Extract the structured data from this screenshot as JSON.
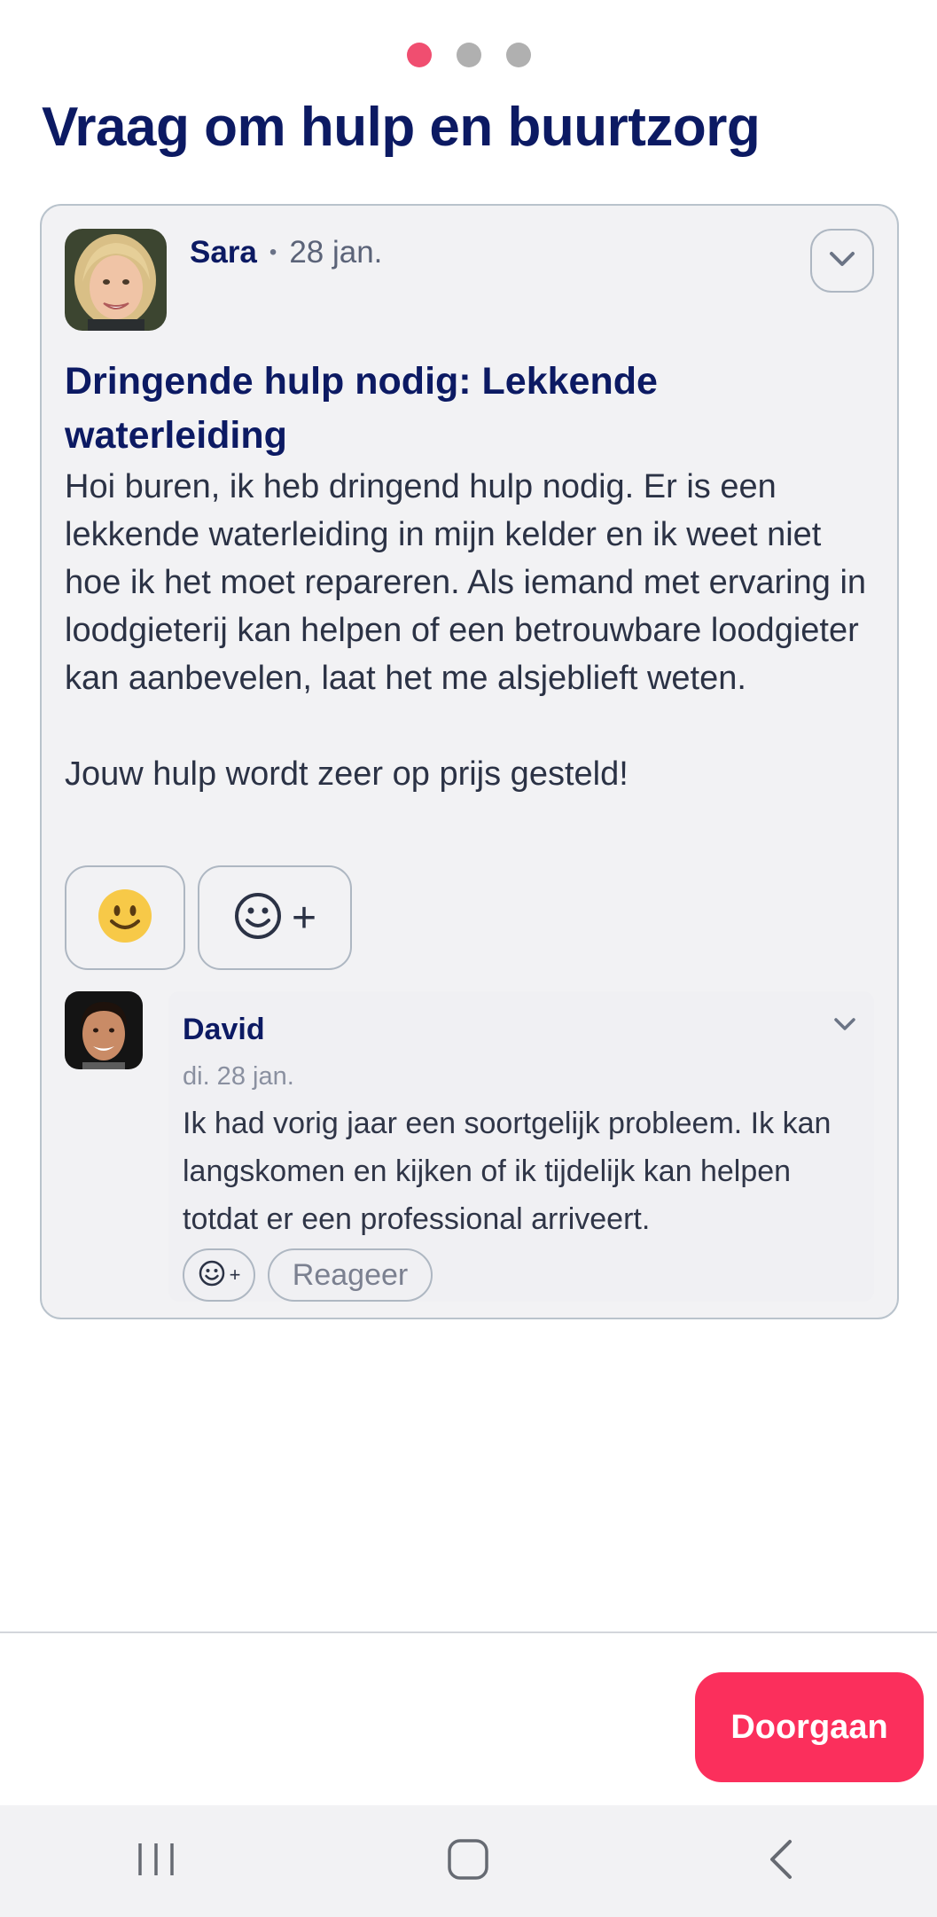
{
  "pager": {
    "total": 3,
    "active_index": 0,
    "active_color": "#f04e70",
    "inactive_color": "#b0b0b0"
  },
  "page": {
    "title": "Vraag om hulp en buurtzorg"
  },
  "post": {
    "author": "Sara",
    "separator": "•",
    "date": "28 jan.",
    "title": "Dringende hulp nodig: Lekkende waterleiding",
    "body": "Hoi buren, ik heb dringend hulp nodig. Er is een lekkende waterleiding in mijn kelder en ik weet niet hoe ik het moet repareren. Als iemand met ervaring in loodgieterij kan helpen of een betrouwbare loodgieter kan aanbevelen, laat het me alsjeblieft weten.\n\nJouw hulp wordt zeer op prijs gesteld!",
    "reactions": {
      "existing_icon": "smiley-emoji",
      "add_label": "+"
    }
  },
  "comment": {
    "author": "David",
    "date": "di. 28 jan.",
    "text": "Ik had vorig jaar een soortgelijk probleem. Ik kan langskomen en kijken of ik tijdelijk kan helpen totdat er een professional arriveert.",
    "add_reaction_label": "+",
    "reply_label": "Reageer"
  },
  "footer": {
    "continue_label": "Doorgaan",
    "accent_color": "#fb2f5c"
  },
  "system_nav": {
    "icons": [
      "recent-apps-icon",
      "home-icon",
      "back-icon"
    ]
  }
}
